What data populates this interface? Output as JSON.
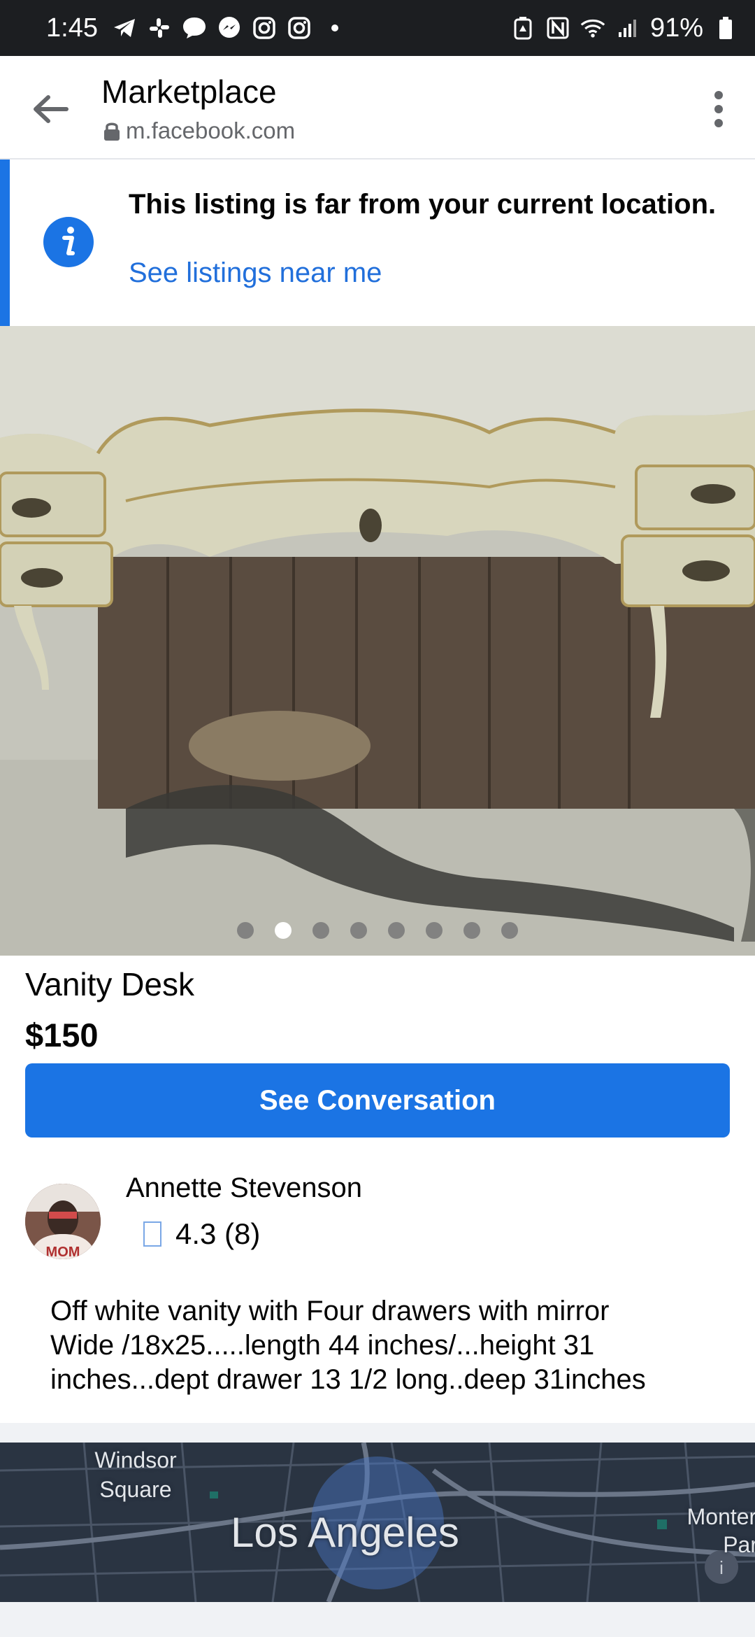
{
  "status_bar": {
    "time": "1:45",
    "battery": "91%"
  },
  "header": {
    "title": "Marketplace",
    "url": "m.facebook.com"
  },
  "banner": {
    "message": "This listing is far from your current location.",
    "link": "See listings near me"
  },
  "gallery": {
    "image_count": 8,
    "active_index": 1
  },
  "listing": {
    "title": "Vanity Desk",
    "price": "$150",
    "cta_label": "See Conversation"
  },
  "seller": {
    "name": "Annette Stevenson",
    "rating": "4.3 (8)",
    "avatar_text": "MOM"
  },
  "description": "Off white vanity with Four drawers with mirror\nWide /18x25.....length 44 inches/...height 31\ninches...dept  drawer 13 1/2 long..deep 31inches",
  "map": {
    "labels": [
      "Windsor Square",
      "Los Angeles",
      "Montere Park"
    ]
  },
  "colors": {
    "accent": "#1b74e4",
    "link": "#216fdb"
  }
}
